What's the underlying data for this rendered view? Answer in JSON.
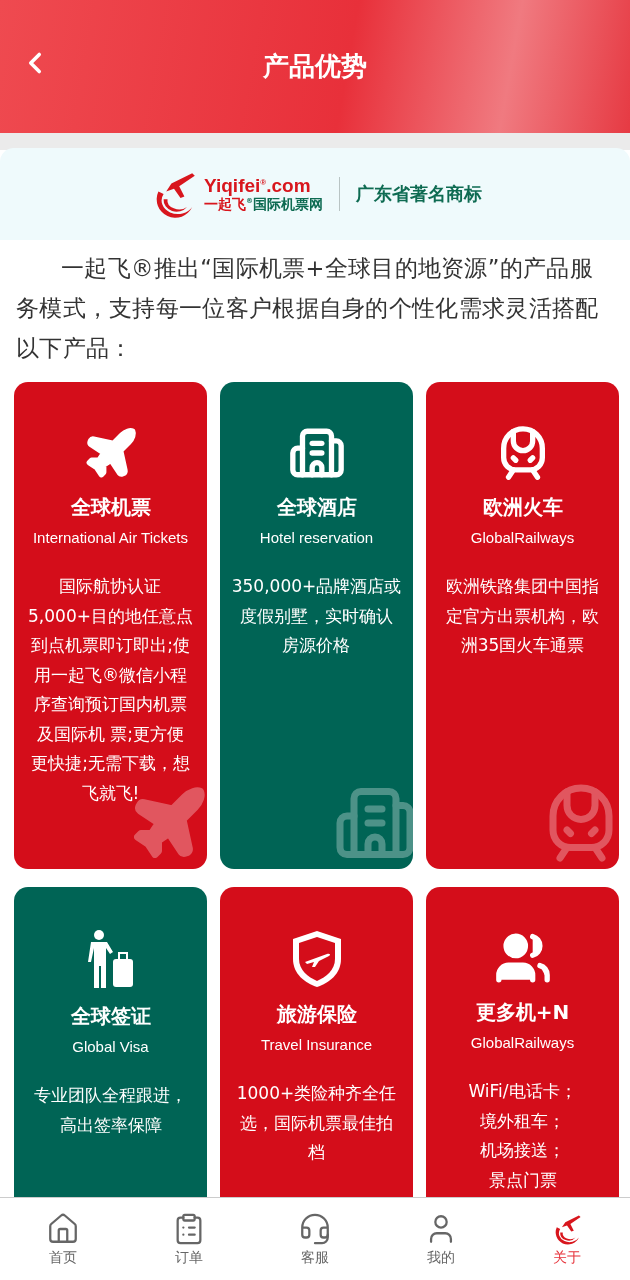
{
  "header": {
    "title": "产品优势"
  },
  "brand": {
    "logo_top": "Yiqifei",
    "logo_sup": "®",
    "logo_domain": ".com",
    "logo_bottom": "一起飞",
    "logo_bottom_sup": "®",
    "logo_sub": "国际机票网",
    "badge": "广东省著名商标"
  },
  "intro": "一起飞®推出“国际机票+全球目的地资源”的产品服务模式，支持每一位客户根据自身的个性化需求灵活搭配以下产品：",
  "products": [
    {
      "title": "全球机票",
      "subtitle": "International Air Tickets",
      "color": "#d40d1a",
      "lines": [
        "国际航协认证",
        "5,000+目的地任意点",
        "到点机票即订即出;使",
        "用一起飞®微信小程",
        "序查询预订国内机票",
        "及国际机 票;更方便",
        "更快捷;无需下载，想",
        "飞就飞!"
      ]
    },
    {
      "title": "全球酒店",
      "subtitle": "Hotel reservation",
      "color": "#006455",
      "lines": [
        "350,000+品牌酒店或",
        "度假别墅，实时确认",
        "房源价格"
      ]
    },
    {
      "title": "欧洲火车",
      "subtitle": "GlobalRailways",
      "color": "#d40d1a",
      "lines": [
        "欧洲铁路集团中国指",
        "定官方出票机构，欧",
        "洲35国火车通票"
      ]
    },
    {
      "title": "全球签证",
      "subtitle": "Global Visa",
      "color": "#006455",
      "lines": [
        "专业团队全程跟进，",
        "高出签率保障"
      ]
    },
    {
      "title": "旅游保险",
      "subtitle": "Travel Insurance",
      "color": "#d40d1a",
      "lines": [
        "1000+类险种齐全任",
        "选，国际机票最佳拍",
        "档"
      ]
    },
    {
      "title": "更多机+N",
      "subtitle": "GlobalRailways",
      "color": "#d40d1a",
      "lines": [
        "WiFi/电话卡；",
        "境外租车；",
        "机场接送；",
        "景点门票"
      ]
    }
  ],
  "tabs": [
    {
      "label": "首页",
      "selected": false
    },
    {
      "label": "订单",
      "selected": false
    },
    {
      "label": "客服",
      "selected": false
    },
    {
      "label": "我的",
      "selected": false
    },
    {
      "label": "关于",
      "selected": true
    }
  ]
}
